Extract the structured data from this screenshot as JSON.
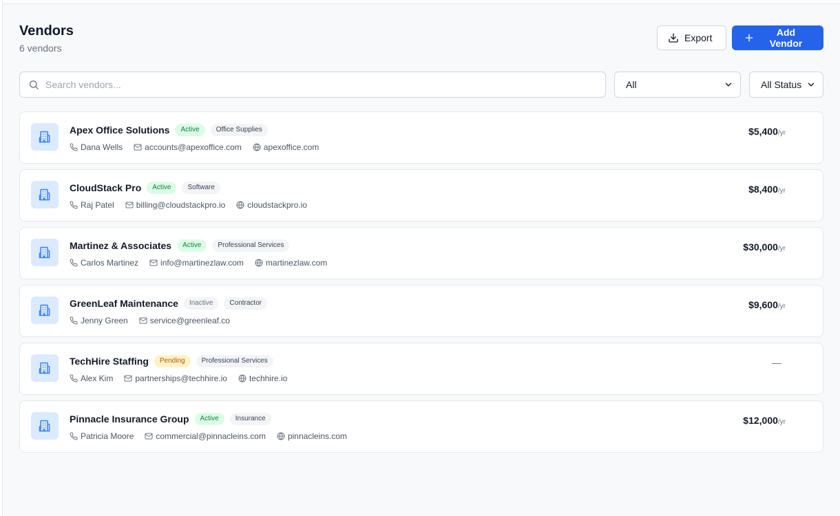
{
  "page": {
    "title": "Vendors",
    "subtitle": "6 vendors"
  },
  "actions": {
    "export_label": "Export",
    "add_label": "Add Vendor"
  },
  "filters": {
    "search_placeholder": "Search vendors...",
    "category_value": "All",
    "status_value": "All Status"
  },
  "colors": {
    "accent": "#2563eb",
    "active_badge": "#dcfce7",
    "pending_badge": "#fef3c7",
    "icon_bg": "#dbeafe"
  },
  "vendors": [
    {
      "name": "Apex Office Solutions",
      "status": "Active",
      "category": "Office Supplies",
      "contact": "Dana Wells",
      "email": "accounts@apexoffice.com",
      "website": "apexoffice.com",
      "amount": "$5,400",
      "period": "/yr"
    },
    {
      "name": "CloudStack Pro",
      "status": "Active",
      "category": "Software",
      "contact": "Raj Patel",
      "email": "billing@cloudstackpro.io",
      "website": "cloudstackpro.io",
      "amount": "$8,400",
      "period": "/yr"
    },
    {
      "name": "Martinez & Associates",
      "status": "Active",
      "category": "Professional Services",
      "contact": "Carlos Martinez",
      "email": "info@martinezlaw.com",
      "website": "martinezlaw.com",
      "amount": "$30,000",
      "period": "/yr"
    },
    {
      "name": "GreenLeaf Maintenance",
      "status": "Inactive",
      "category": "Contractor",
      "contact": "Jenny Green",
      "email": "service@greenleaf.co",
      "website": null,
      "amount": "$9,600",
      "period": "/yr"
    },
    {
      "name": "TechHire Staffing",
      "status": "Pending",
      "category": "Professional Services",
      "contact": "Alex Kim",
      "email": "partnerships@techhire.io",
      "website": "techhire.io",
      "amount": null,
      "period": null,
      "amount_placeholder": "—"
    },
    {
      "name": "Pinnacle Insurance Group",
      "status": "Active",
      "category": "Insurance",
      "contact": "Patricia Moore",
      "email": "commercial@pinnacleins.com",
      "website": "pinnacleins.com",
      "amount": "$12,000",
      "period": "/yr"
    }
  ]
}
